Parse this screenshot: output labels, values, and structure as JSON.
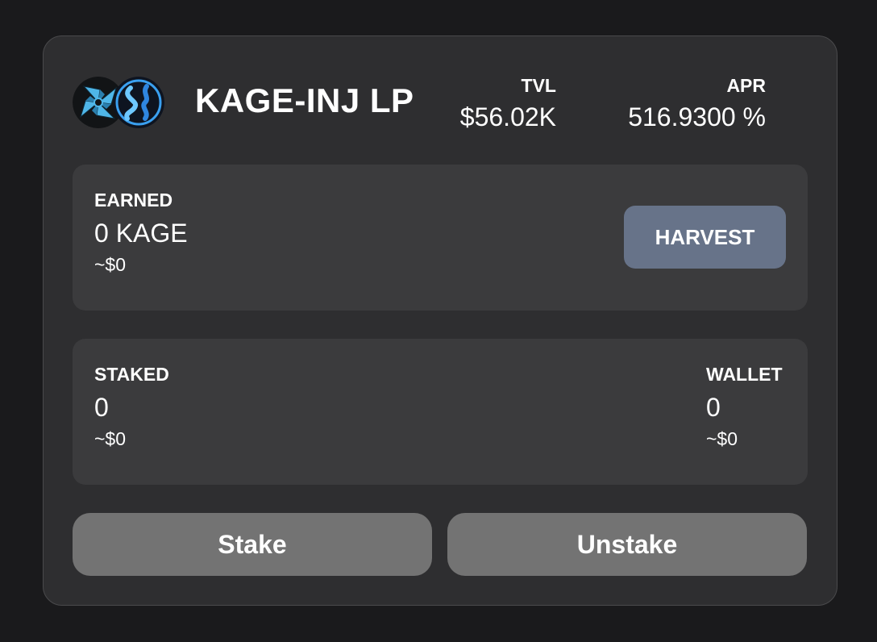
{
  "pool": {
    "name": "KAGE-INJ LP",
    "icons": [
      "kage-token-icon",
      "inj-token-icon"
    ],
    "tvl_label": "TVL",
    "tvl_value": "$56.02K",
    "apr_label": "APR",
    "apr_value": "516.9300 %"
  },
  "earned": {
    "label": "EARNED",
    "amount": "0 KAGE",
    "usd": "~$0",
    "harvest_label": "HARVEST"
  },
  "staked": {
    "label": "STAKED",
    "amount": "0",
    "usd": "~$0"
  },
  "wallet": {
    "label": "WALLET",
    "amount": "0",
    "usd": "~$0"
  },
  "actions": {
    "stake_label": "Stake",
    "unstake_label": "Unstake"
  },
  "colors": {
    "background": "#1a1a1c",
    "card": "#2e2e30",
    "panel": "#3b3b3d",
    "harvest_button": "#677389",
    "action_button": "#737373",
    "kage_accent": "#4fb6e8",
    "inj_accent": "#3aa0f0"
  }
}
